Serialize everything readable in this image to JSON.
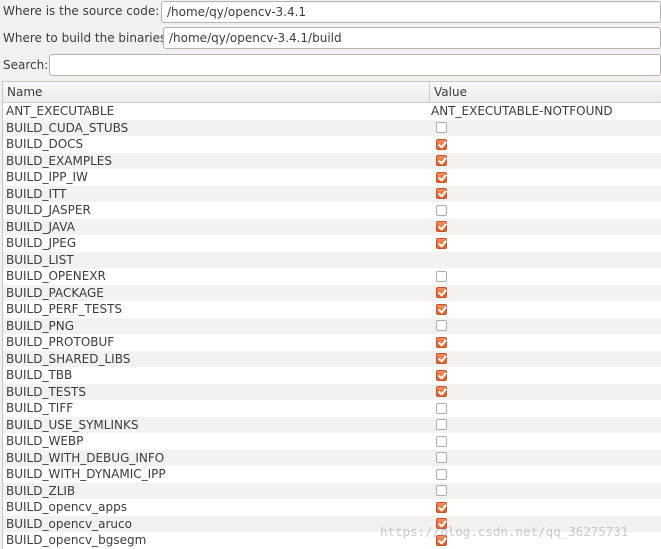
{
  "header": {
    "source_label": "Where is the source code:",
    "source_value": "/home/qy/opencv-3.4.1",
    "build_label": "Where to build the binaries:",
    "build_value": "/home/qy/opencv-3.4.1/build",
    "search_label": "Search:",
    "search_value": ""
  },
  "table": {
    "columns": [
      "Name",
      "Value"
    ],
    "rows": [
      {
        "name": "ANT_EXECUTABLE",
        "type": "text",
        "value": "ANT_EXECUTABLE-NOTFOUND"
      },
      {
        "name": "BUILD_CUDA_STUBS",
        "type": "bool",
        "checked": false
      },
      {
        "name": "BUILD_DOCS",
        "type": "bool",
        "checked": true
      },
      {
        "name": "BUILD_EXAMPLES",
        "type": "bool",
        "checked": true
      },
      {
        "name": "BUILD_IPP_IW",
        "type": "bool",
        "checked": true
      },
      {
        "name": "BUILD_ITT",
        "type": "bool",
        "checked": true
      },
      {
        "name": "BUILD_JASPER",
        "type": "bool",
        "checked": false
      },
      {
        "name": "BUILD_JAVA",
        "type": "bool",
        "checked": true
      },
      {
        "name": "BUILD_JPEG",
        "type": "bool",
        "checked": true
      },
      {
        "name": "BUILD_LIST",
        "type": "text",
        "value": ""
      },
      {
        "name": "BUILD_OPENEXR",
        "type": "bool",
        "checked": false
      },
      {
        "name": "BUILD_PACKAGE",
        "type": "bool",
        "checked": true
      },
      {
        "name": "BUILD_PERF_TESTS",
        "type": "bool",
        "checked": true
      },
      {
        "name": "BUILD_PNG",
        "type": "bool",
        "checked": false
      },
      {
        "name": "BUILD_PROTOBUF",
        "type": "bool",
        "checked": true
      },
      {
        "name": "BUILD_SHARED_LIBS",
        "type": "bool",
        "checked": true
      },
      {
        "name": "BUILD_TBB",
        "type": "bool",
        "checked": true
      },
      {
        "name": "BUILD_TESTS",
        "type": "bool",
        "checked": true
      },
      {
        "name": "BUILD_TIFF",
        "type": "bool",
        "checked": false
      },
      {
        "name": "BUILD_USE_SYMLINKS",
        "type": "bool",
        "checked": false
      },
      {
        "name": "BUILD_WEBP",
        "type": "bool",
        "checked": false
      },
      {
        "name": "BUILD_WITH_DEBUG_INFO",
        "type": "bool",
        "checked": false
      },
      {
        "name": "BUILD_WITH_DYNAMIC_IPP",
        "type": "bool",
        "checked": false
      },
      {
        "name": "BUILD_ZLIB",
        "type": "bool",
        "checked": false
      },
      {
        "name": "BUILD_opencv_apps",
        "type": "bool",
        "checked": true
      },
      {
        "name": "BUILD_opencv_aruco",
        "type": "bool",
        "checked": true
      },
      {
        "name": "BUILD_opencv_bgsegm",
        "type": "bool",
        "checked": true
      }
    ]
  },
  "colors": {
    "accent": "#e8683a",
    "background": "#f2f1f0"
  },
  "watermark": "https://blog.csdn.net/qq_36275731"
}
